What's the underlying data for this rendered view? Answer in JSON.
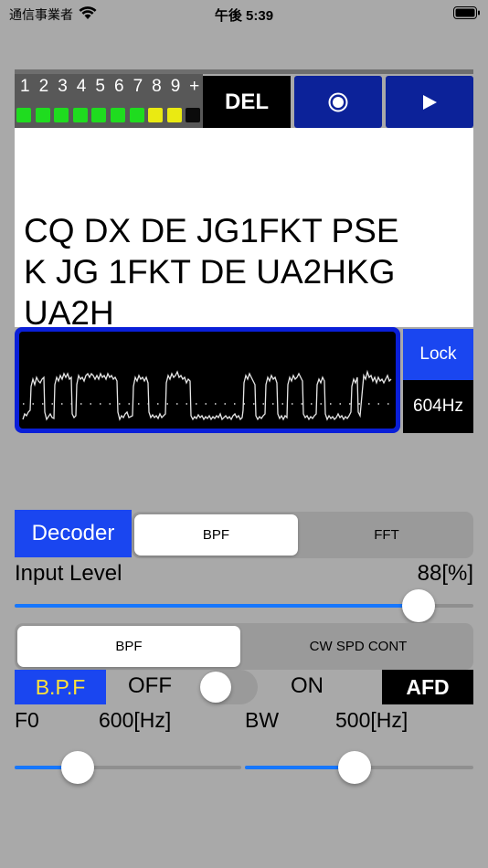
{
  "status_bar": {
    "carrier": "通信事業者",
    "time": "午後 5:39"
  },
  "meter": {
    "labels": [
      "1",
      "2",
      "3",
      "4",
      "5",
      "6",
      "7",
      "8",
      "9",
      "+"
    ],
    "leds": [
      "green",
      "green",
      "green",
      "green",
      "green",
      "green",
      "green",
      "yellow",
      "yellow",
      "off"
    ],
    "led_colors": {
      "green": "#1fdc1f",
      "yellow": "#eaea12",
      "off": "#0b0b0b"
    }
  },
  "toolbar": {
    "del_label": "DEL",
    "record_icon": "record-icon",
    "play_icon": "play-icon",
    "accent": "#0c2299"
  },
  "decoded": {
    "lines": [
      "CQ DX DE JG1FKT PSE",
      "K JG 1FKT DE UA2HKG",
      "UA2H"
    ]
  },
  "scope": {
    "lock_label": "Lock",
    "frequency": "604Hz"
  },
  "decoder": {
    "label": "Decoder",
    "modes": [
      "BPF",
      "FFT"
    ],
    "selected_mode": "BPF"
  },
  "input_level": {
    "label": "Input Level",
    "value": "88[%]",
    "level": 0.88
  },
  "filter_tabs": {
    "items": [
      "BPF",
      "CW SPD CONT"
    ],
    "selected": "BPF"
  },
  "bpf_row": {
    "label": "B.P.F",
    "off_label": "OFF",
    "on_label": "ON",
    "toggle_on": false,
    "afd_label": "AFD"
  },
  "filter_params": {
    "f0_label": "F0",
    "f0_value": "600[Hz]",
    "f0_level": 0.28,
    "bw_label": "BW",
    "bw_value": "500[Hz]",
    "bw_level": 0.48
  }
}
